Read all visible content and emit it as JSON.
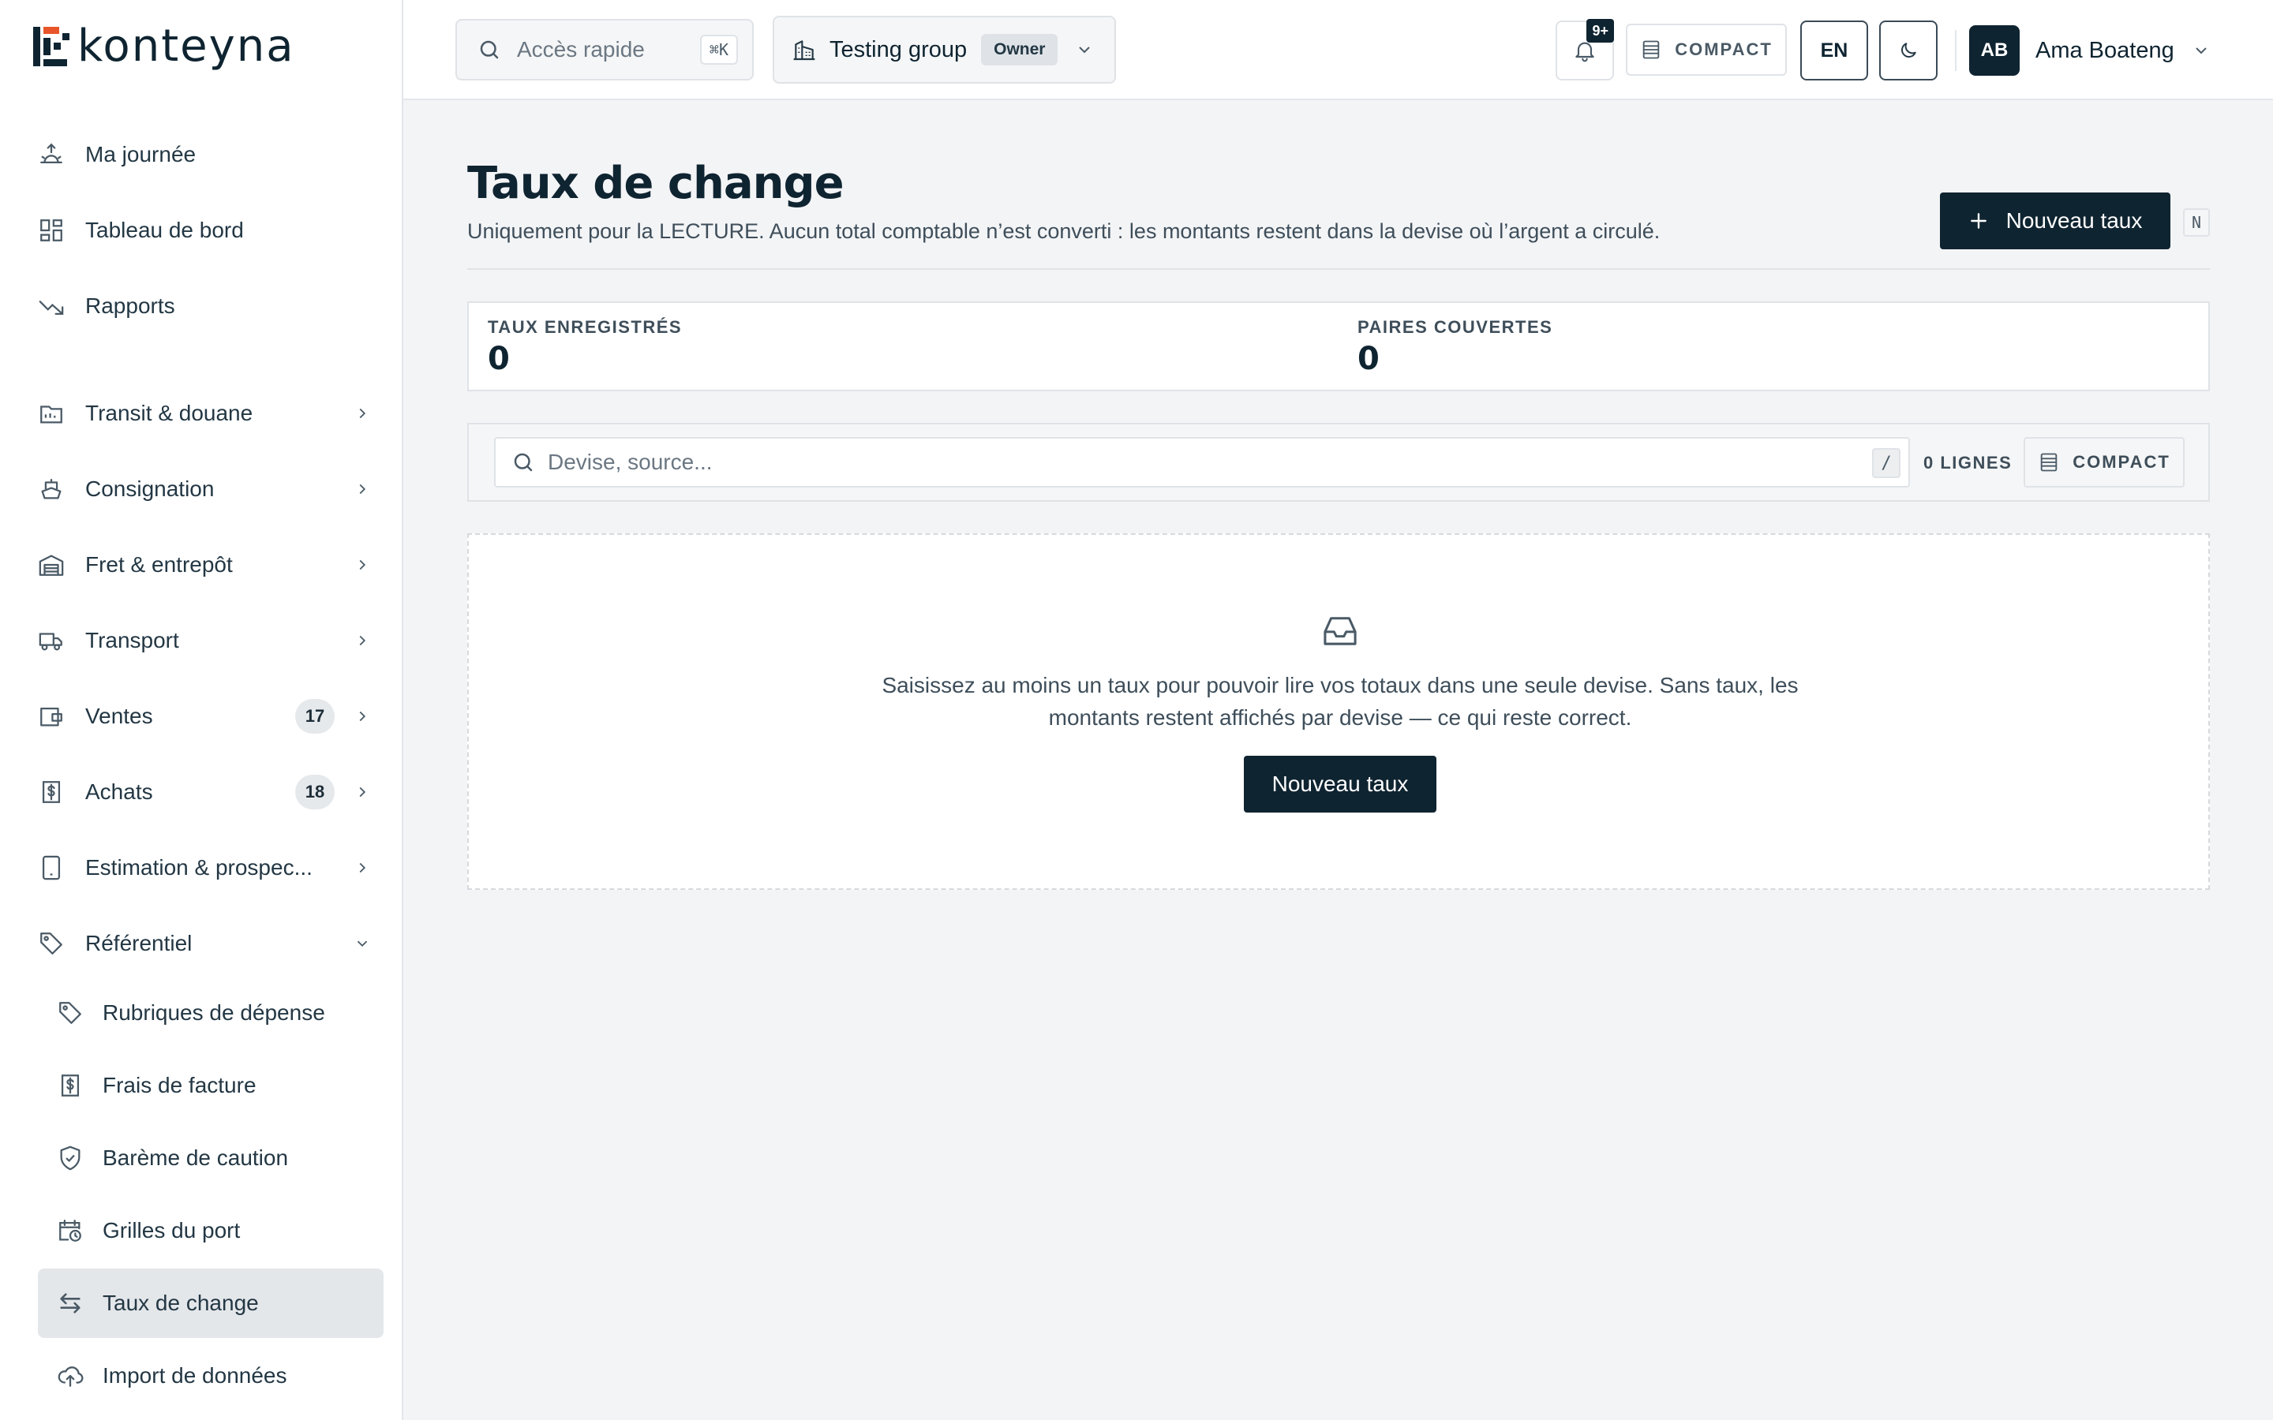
{
  "app": {
    "logo_text": "konteyna"
  },
  "sidebar": {
    "primary": [
      {
        "label": "Ma journée",
        "icon": "sunrise-icon"
      },
      {
        "label": "Tableau de bord",
        "icon": "dashboard-icon"
      },
      {
        "label": "Rapports",
        "icon": "trend-down-icon"
      }
    ],
    "sections": [
      {
        "label": "Transit & douane",
        "icon": "customs-icon",
        "badge": ""
      },
      {
        "label": "Consignation",
        "icon": "ship-icon",
        "badge": ""
      },
      {
        "label": "Fret & entrepôt",
        "icon": "warehouse-icon",
        "badge": ""
      },
      {
        "label": "Transport",
        "icon": "truck-icon",
        "badge": ""
      },
      {
        "label": "Ventes",
        "icon": "wallet-icon",
        "badge": "17"
      },
      {
        "label": "Achats",
        "icon": "dollar-doc-icon",
        "badge": "18"
      },
      {
        "label": "Estimation & prospec...",
        "icon": "tablet-icon",
        "badge": ""
      },
      {
        "label": "Référentiel",
        "icon": "tag-icon",
        "badge": ""
      }
    ],
    "sub_items": [
      {
        "label": "Rubriques de dépense",
        "icon": "tag-icon"
      },
      {
        "label": "Frais de facture",
        "icon": "dollar-doc-icon"
      },
      {
        "label": "Barème de caution",
        "icon": "shield-check-icon"
      },
      {
        "label": "Grilles du port",
        "icon": "calendar-clock-icon"
      },
      {
        "label": "Taux de change",
        "icon": "swap-arrows-icon"
      },
      {
        "label": "Import de données",
        "icon": "cloud-upload-icon"
      }
    ]
  },
  "topbar": {
    "quick_access": {
      "placeholder": "Accès rapide",
      "shortcut": "⌘K"
    },
    "group": {
      "name": "Testing group",
      "role": "Owner"
    },
    "notifications": {
      "badge": "9+"
    },
    "compact_label": "COMPACT",
    "language": "EN",
    "user": {
      "initials": "AB",
      "name": "Ama Boateng"
    }
  },
  "page": {
    "title": "Taux de change",
    "subtitle": "Uniquement pour la LECTURE. Aucun total comptable n’est converti : les montants restent dans la devise où l’argent a circulé.",
    "new_rate_label": "Nouveau taux",
    "new_rate_shortcut": "N"
  },
  "stats": {
    "rates_label": "TAUX ENREGISTRÉS",
    "rates_value": "0",
    "pairs_label": "PAIRES COUVERTES",
    "pairs_value": "0"
  },
  "filter": {
    "search_placeholder": "Devise, source...",
    "search_shortcut": "/",
    "lines_count": "0 LIGNES",
    "compact_label": "COMPACT"
  },
  "empty_state": {
    "icon": "inbox-icon",
    "message": "Saisissez au moins un taux pour pouvoir lire vos totaux dans une seule devise. Sans taux, les montants restent affichés par devise — ce qui reste correct.",
    "button_label": "Nouveau taux"
  },
  "colors": {
    "primary": "#0f2431",
    "background": "#f3f4f6",
    "active_item": "#e4e7ea",
    "logo_accent": "#e8552a"
  }
}
